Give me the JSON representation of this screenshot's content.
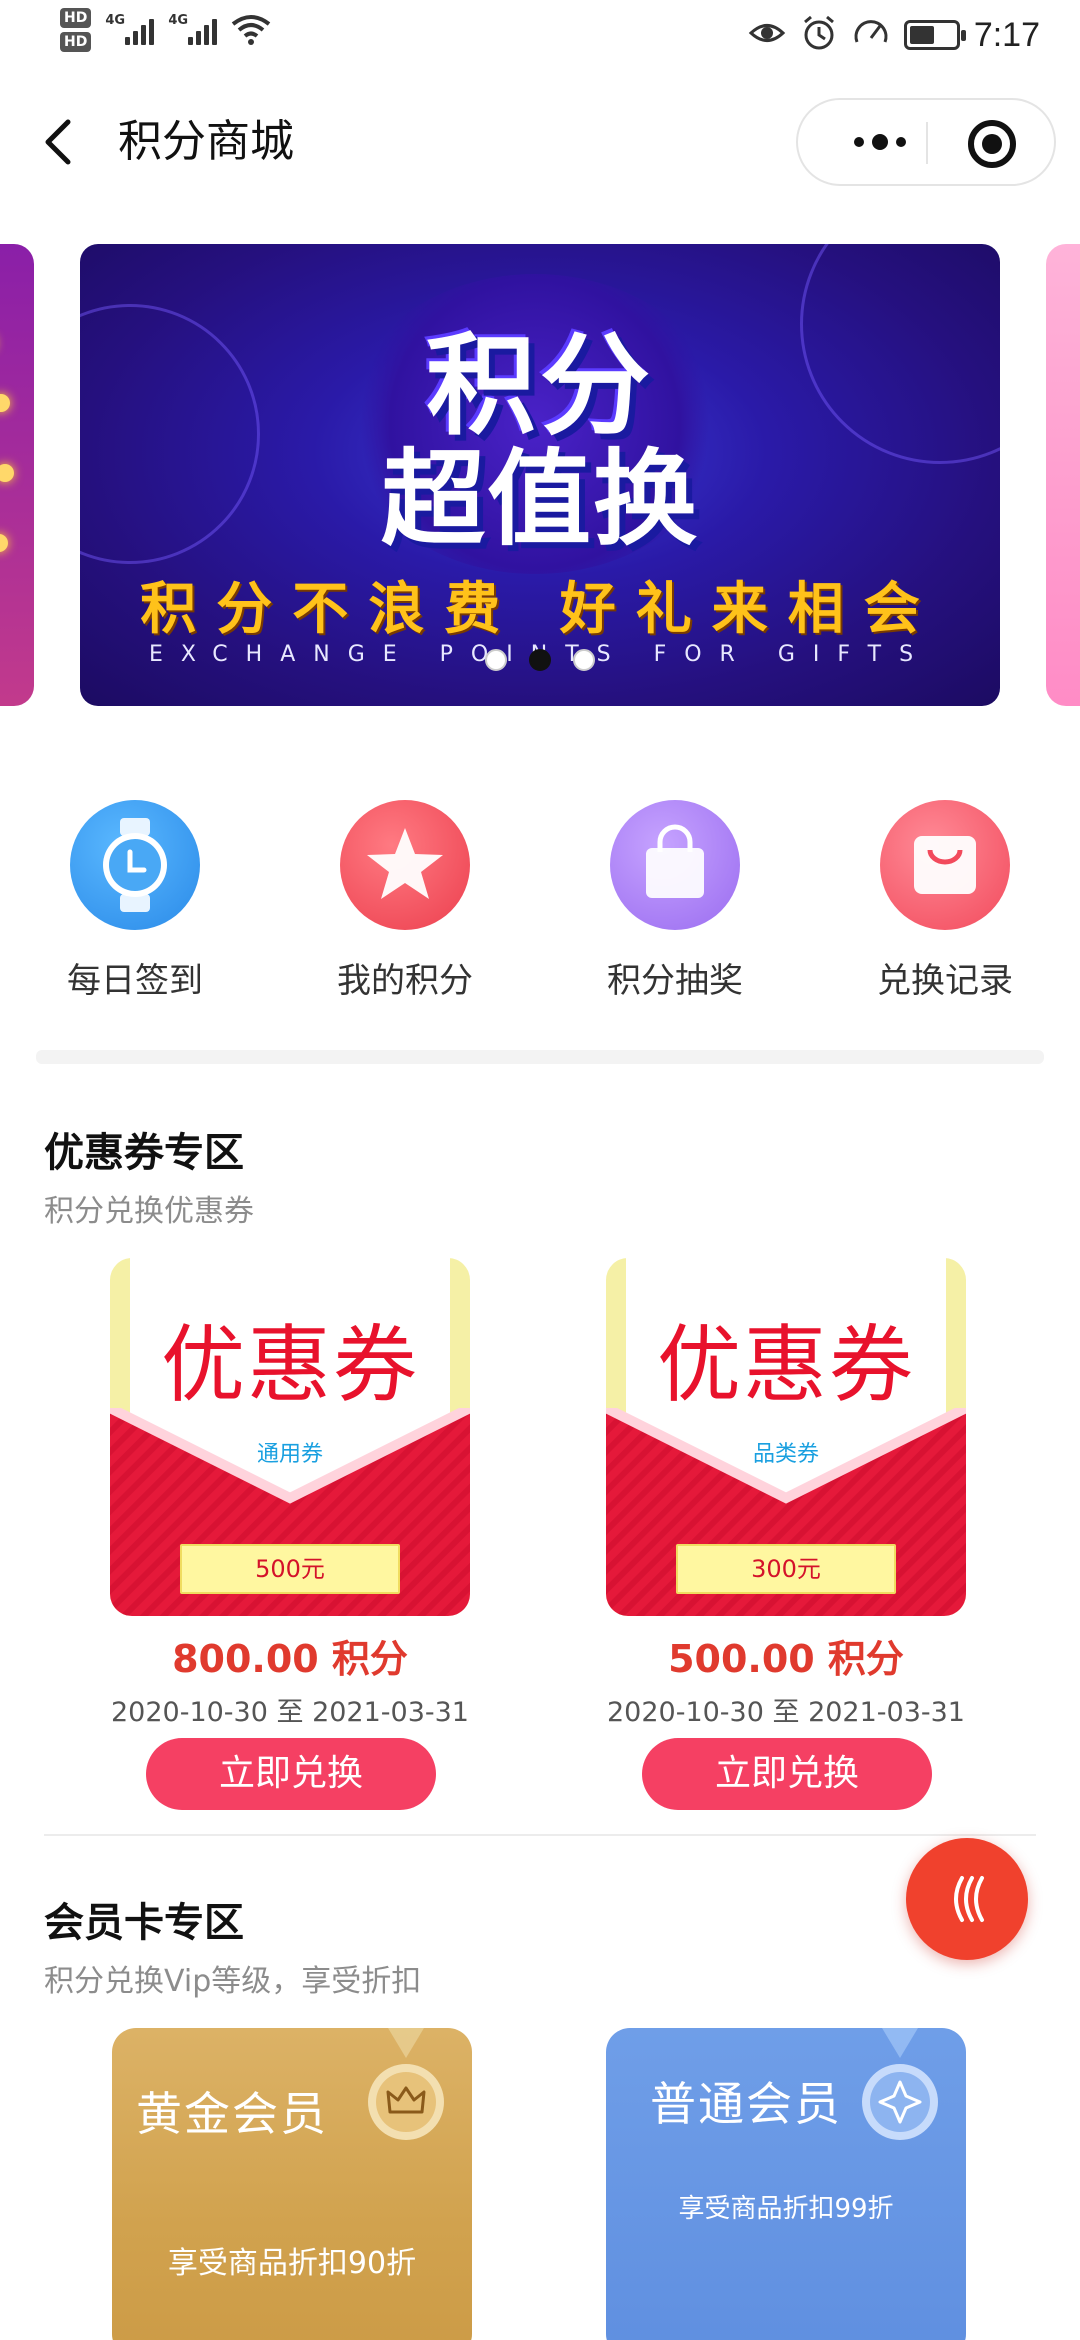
{
  "status_bar": {
    "hd1": "HD",
    "hd2": "HD",
    "net1": "4G",
    "net2": "4G",
    "time": "7:17",
    "battery_level": 0.55
  },
  "nav": {
    "title": "积分商城"
  },
  "banner": {
    "headline_line1": "积分",
    "headline_line2": "超值换",
    "slogan": "积分不浪费  好礼来相会",
    "english": "EXCHANGE POINTS FOR GIFTS",
    "active_slide": 2,
    "slides": 3
  },
  "quick_menu": [
    {
      "label": "每日签到",
      "icon": "watch-icon",
      "color": "#3a9cf0"
    },
    {
      "label": "我的积分",
      "icon": "star-icon",
      "color": "#f0505a"
    },
    {
      "label": "积分抽奖",
      "icon": "shopping-bag-icon",
      "color": "#a77df0"
    },
    {
      "label": "兑换记录",
      "icon": "gift-bag-icon",
      "color": "#f55a6a"
    }
  ],
  "coupon_section": {
    "title": "优惠券专区",
    "subtitle": "积分兑换优惠券",
    "items": [
      {
        "head": "优惠券",
        "kind": "通用券",
        "amount": "500元",
        "points": "800.00 积分",
        "dates": "2020-10-30 至 2021-03-31",
        "button": "立即兑换"
      },
      {
        "head": "优惠券",
        "kind": "品类券",
        "amount": "300元",
        "points": "500.00 积分",
        "dates": "2020-10-30 至 2021-03-31",
        "button": "立即兑换"
      }
    ]
  },
  "member_section": {
    "title": "会员卡专区",
    "subtitle": "积分兑换Vip等级，享受折扣",
    "cards": [
      {
        "name": "黄金会员",
        "desc": "享受商品折扣90折",
        "icon": "crown-medal-icon",
        "color": "#d1a24e"
      },
      {
        "name": "普通会员",
        "desc": "享受商品折扣99折",
        "icon": "star-medal-icon",
        "color": "#5f8fe0"
      }
    ]
  },
  "fab": {
    "icon": "wave-lines-icon",
    "color": "#f0412d"
  }
}
